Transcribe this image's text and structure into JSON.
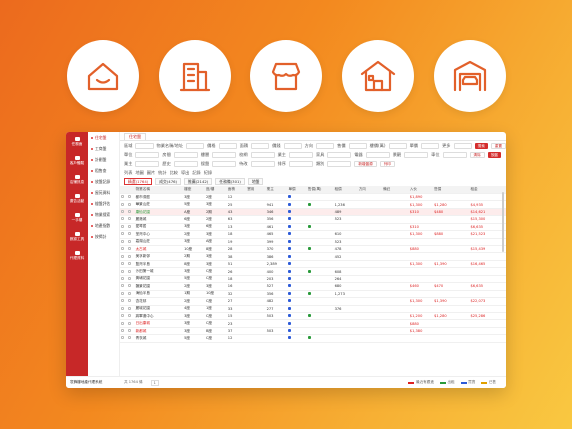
{
  "icons": [
    {
      "name": "house-smile-icon"
    },
    {
      "name": "building-icon"
    },
    {
      "name": "shop-awning-icon"
    },
    {
      "name": "house-icon"
    },
    {
      "name": "garage-car-icon"
    }
  ],
  "window": {
    "sidebar": [
      "任務面",
      "客戶體驗",
      "店鋪訊息",
      "廣告活動",
      "一手樓",
      "數據工具",
      "代理資料"
    ],
    "submenu": [
      "住宅盤",
      "工商盤",
      "計劃盤",
      "租售查",
      "放盤記錄",
      "屋苑資料",
      "樓盤評估",
      "物業搜索",
      "地產指數",
      "按揭計"
    ],
    "company": "寰鋒樓地產代理系統",
    "tab": "住宅盤",
    "filters": [
      [
        "區域",
        "物業名稱/地址",
        "價格",
        "面積",
        "價錢",
        "方向",
        "售價",
        "樓價(萬)",
        "單價",
        "更多"
      ],
      [
        "單位",
        "房間",
        "樓層",
        "校網",
        "業主",
        "家具",
        "電器",
        "景觀",
        "車位"
      ],
      [
        "業主",
        "歷史",
        "搜盤",
        "待改",
        "排序",
        "類別"
      ]
    ],
    "buttons": {
      "search": "搜索",
      "reset": "重置",
      "clear": "清除",
      "save": "放盤",
      "add": "新增盤源",
      "print": "列印"
    },
    "views": [
      "列表",
      "地圖",
      "圖片",
      "統計",
      "比較",
      "導出",
      "記錄",
      "紀錄"
    ],
    "qtabs": [
      "精選(1764)",
      "成交(476)",
      "推薦(2142)",
      "任務備(301)",
      "地盤"
    ],
    "columns": [
      "",
      "",
      "物業名稱",
      "樓座",
      "座/樓",
      "面積",
      "實用",
      "業主",
      "單價",
      "售價(萬)",
      "租價",
      "方向",
      "備註",
      "入伙",
      "售價",
      "租金"
    ],
    "rows": [
      [
        "都市濠庭",
        "3座",
        "2座",
        "12",
        "",
        "",
        "",
        "",
        "$1,890",
        "",
        "",
        "$1,280"
      ],
      [
        "華景山莊",
        "5座",
        "3座",
        "25",
        "941",
        "1,236",
        "",
        "",
        "$1,300",
        "$1,280",
        "$4,935"
      ],
      [
        "康怡花園",
        "A座",
        "2期",
        "43",
        "346",
        "489",
        "",
        "",
        "$310",
        "$480",
        "$14,621"
      ],
      [
        "麗港城",
        "6座",
        "2座",
        "63",
        "356",
        "523",
        "",
        "",
        "",
        "",
        "$15,300"
      ],
      [
        "愛琴居",
        "3座",
        "6座",
        "13",
        "461",
        "",
        "",
        "",
        "$310",
        "",
        "$6,635"
      ],
      [
        "荃灣中心",
        "2座",
        "3座",
        "18",
        "465",
        "610",
        "",
        "",
        "$1,300",
        "$880",
        "$21,523"
      ],
      [
        "嘉湖山莊",
        "3座",
        "A座",
        "19",
        "399",
        "523",
        "",
        "",
        "",
        "",
        ""
      ],
      [
        "太古城",
        "10座",
        "8座",
        "28",
        "370",
        "478",
        "",
        "",
        "$880",
        "",
        "$15,439"
      ],
      [
        "美孚新邨",
        "2期",
        "3座",
        "38",
        "386",
        "452",
        "",
        "",
        "",
        "",
        ""
      ],
      [
        "藍灣半島",
        "8座",
        "3座",
        "51",
        "2,389",
        "",
        "",
        "",
        "$1,300",
        "$1,390",
        "$16,465"
      ],
      [
        "沙田第一城",
        "3座",
        "C座",
        "26",
        "400",
        "608",
        "",
        "",
        "",
        "",
        ""
      ],
      [
        "黃埔花園",
        "5座",
        "C座",
        "18",
        "203",
        "264",
        "",
        "",
        "",
        "",
        ""
      ],
      [
        "匯景花園",
        "2座",
        "3座",
        "16",
        "527",
        "680",
        "",
        "",
        "$460",
        "$470",
        "$6,635"
      ],
      [
        "海怡半島",
        "1期",
        "10座",
        "32",
        "356",
        "1,273",
        "",
        "",
        "",
        "",
        ""
      ],
      [
        "杏花邨",
        "2座",
        "C座",
        "27",
        "482",
        "",
        "",
        "",
        "$1,300",
        "$1,390",
        "$22,073"
      ],
      [
        "麗城花園",
        "4座",
        "1座",
        "33",
        "277",
        "376",
        "",
        "",
        "",
        "",
        ""
      ],
      [
        "將軍澳中心",
        "3座",
        "C座",
        "15",
        "503",
        "",
        "",
        "",
        "$1,200",
        "$1,280",
        "$25,286"
      ],
      [
        "日出康城",
        "3座",
        "C座",
        "23",
        "",
        "",
        "",
        "",
        "$880",
        "",
        ""
      ],
      [
        "新都城",
        "3座",
        "B座",
        "37",
        "503",
        "",
        "",
        "",
        "$1,380",
        "",
        ""
      ],
      [
        "青衣城",
        "5座",
        "C座",
        "12",
        "",
        "",
        "",
        "",
        "",
        "",
        ""
      ]
    ],
    "pager": {
      "count": "共 1764 條",
      "page": "1"
    },
    "legend": [
      "最近有跟進",
      "出租",
      "買賣",
      "已售"
    ]
  }
}
